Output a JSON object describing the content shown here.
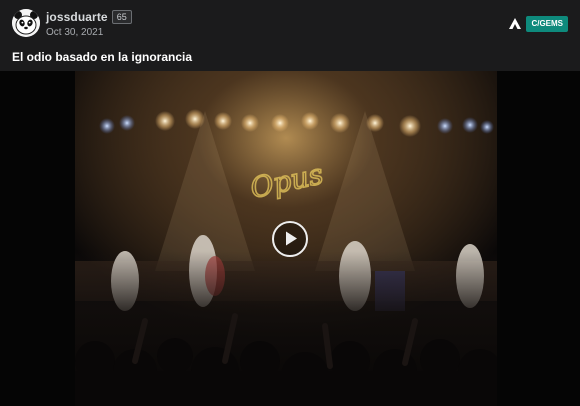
{
  "post": {
    "username": "jossduarte",
    "level": "65",
    "date": "Oct 30, 2021",
    "title": "El odio basado en la ignorancia",
    "community": "C/GEMS",
    "avatar_icon": "panda-icon",
    "community_icon": "community-logo-icon"
  },
  "media": {
    "type": "video",
    "play_icon": "play-icon",
    "overlay_logo_text": "Opus"
  },
  "colors": {
    "background": "#1b1b1c",
    "community_badge": "#0e8a7c",
    "title_text": "#ffffff"
  }
}
